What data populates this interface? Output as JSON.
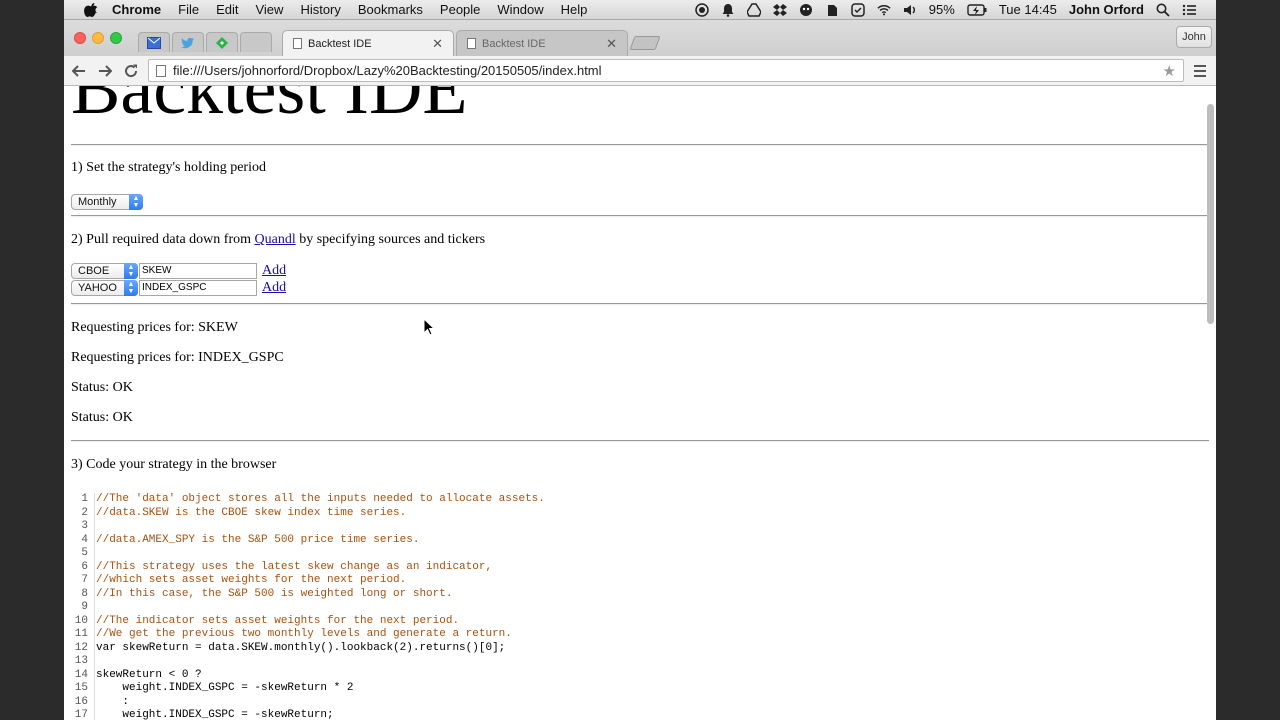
{
  "menubar": {
    "app": "Chrome",
    "items": [
      "File",
      "Edit",
      "View",
      "History",
      "Bookmarks",
      "People",
      "Window",
      "Help"
    ],
    "battery": "95%",
    "clock": "Tue 14:45",
    "user": "John Orford"
  },
  "tabs": {
    "active": "Backtest IDE",
    "inactive": "Backtest IDE",
    "profile": "John"
  },
  "address": {
    "url": "file:///Users/johnorford/Dropbox/Lazy%20Backtesting/20150505/index.html"
  },
  "page": {
    "title": "Backtest IDE",
    "step1": "1) Set the strategy's holding period",
    "holding_period": "Monthly",
    "step2_prefix": "2) Pull required data down from ",
    "step2_link": "Quandl",
    "step2_suffix": " by specifying sources and tickers",
    "sources": [
      {
        "source": "CBOE",
        "ticker": "SKEW",
        "action": "Add"
      },
      {
        "source": "YAHOO",
        "ticker": "INDEX_GSPC",
        "action": "Add"
      }
    ],
    "log": [
      "Requesting prices for: SKEW",
      "Requesting prices for: INDEX_GSPC",
      "Status: OK",
      "Status: OK"
    ],
    "step3": "3) Code your strategy in the browser",
    "code_lines": [
      {
        "n": "1",
        "t": "//The 'data' object stores all the inputs needed to allocate assets.",
        "c": true
      },
      {
        "n": "2",
        "t": "//data.SKEW is the CBOE skew index time series.",
        "c": true
      },
      {
        "n": "3",
        "t": "",
        "c": false
      },
      {
        "n": "4",
        "t": "//data.AMEX_SPY is the S&P 500 price time series.",
        "c": true
      },
      {
        "n": "5",
        "t": "",
        "c": false
      },
      {
        "n": "6",
        "t": "//This strategy uses the latest skew change as an indicator,",
        "c": true
      },
      {
        "n": "7",
        "t": "//which sets asset weights for the next period.",
        "c": true
      },
      {
        "n": "8",
        "t": "//In this case, the S&P 500 is weighted long or short.",
        "c": true
      },
      {
        "n": "9",
        "t": "",
        "c": false
      },
      {
        "n": "10",
        "t": "//The indicator sets asset weights for the next period.",
        "c": true
      },
      {
        "n": "11",
        "t": "//We get the previous two monthly levels and generate a return.",
        "c": true
      },
      {
        "n": "12",
        "t": "var skewReturn = data.SKEW.monthly().lookback(2).returns()[0];",
        "c": false
      },
      {
        "n": "13",
        "t": "",
        "c": false
      },
      {
        "n": "14",
        "t": "skewReturn < 0 ?",
        "c": false
      },
      {
        "n": "15",
        "t": "    weight.INDEX_GSPC = -skewReturn * 2",
        "c": false
      },
      {
        "n": "16",
        "t": "    :",
        "c": false
      },
      {
        "n": "17",
        "t": "    weight.INDEX_GSPC = -skewReturn;",
        "c": false
      }
    ]
  }
}
